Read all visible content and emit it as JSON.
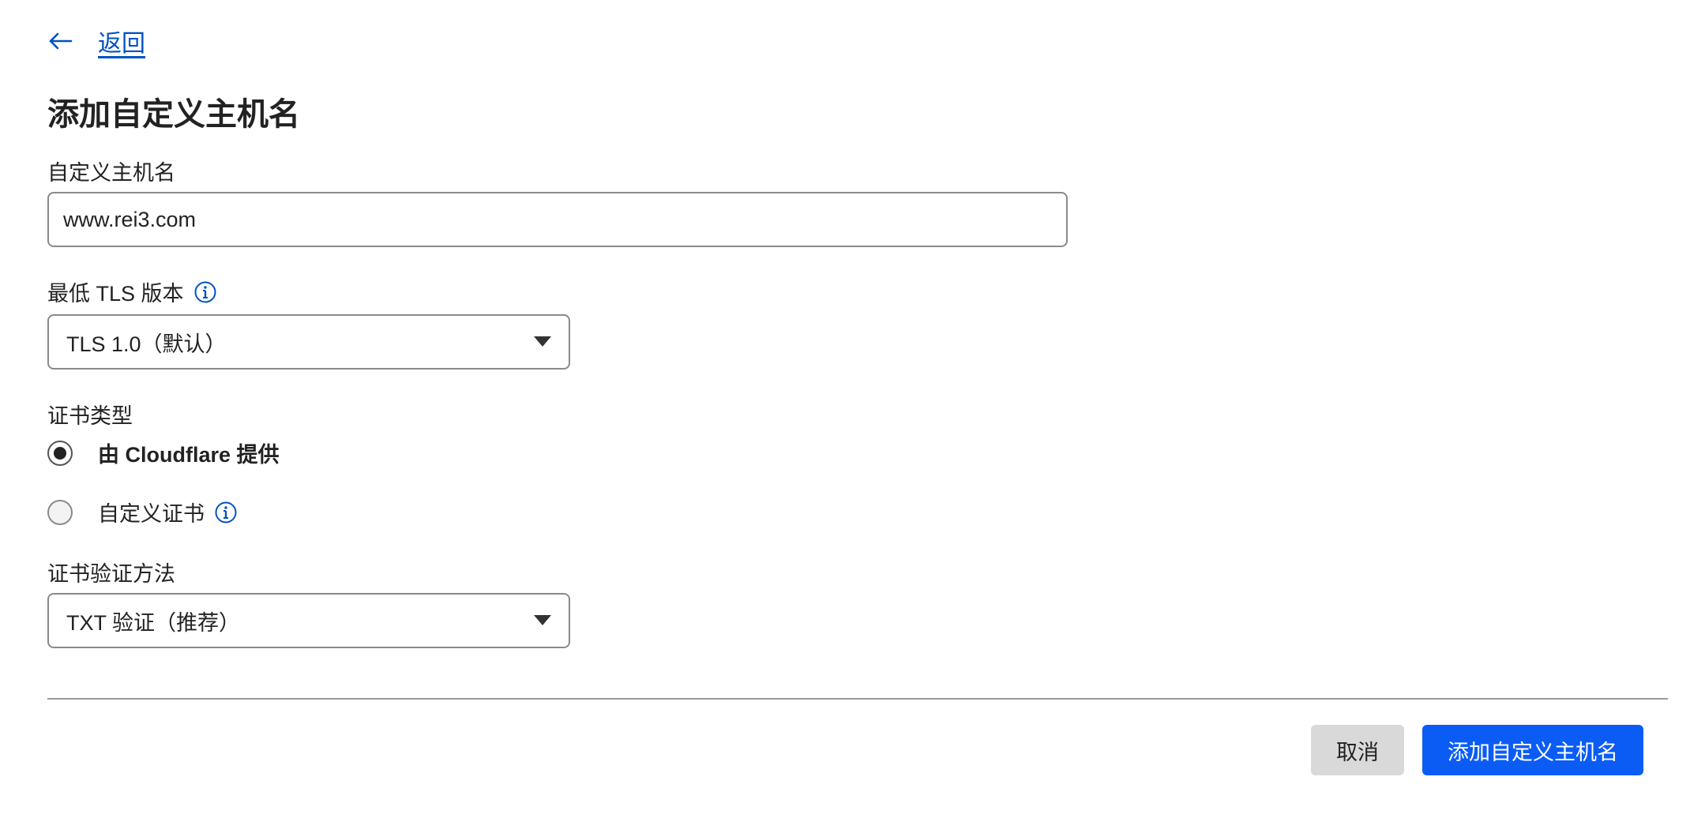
{
  "header": {
    "back_label": "返回",
    "title": "添加自定义主机名"
  },
  "form": {
    "hostname": {
      "label": "自定义主机名",
      "value": "www.rei3.com"
    },
    "tls": {
      "label": "最低 TLS 版本",
      "selected": "TLS 1.0（默认）"
    },
    "cert_type": {
      "label": "证书类型",
      "options": [
        {
          "label": "由 Cloudflare 提供",
          "checked": true
        },
        {
          "label": "自定义证书",
          "checked": false
        }
      ]
    },
    "validation": {
      "label": "证书验证方法",
      "selected": "TXT 验证（推荐）"
    }
  },
  "footer": {
    "cancel_label": "取消",
    "submit_label": "添加自定义主机名"
  },
  "colors": {
    "link": "#0051c3",
    "primary": "#0a5cf5",
    "cancel_bg": "#d9d9d9"
  },
  "icons": {
    "back": "arrow-left-icon",
    "info": "info-icon",
    "dropdown": "caret-down-icon"
  }
}
